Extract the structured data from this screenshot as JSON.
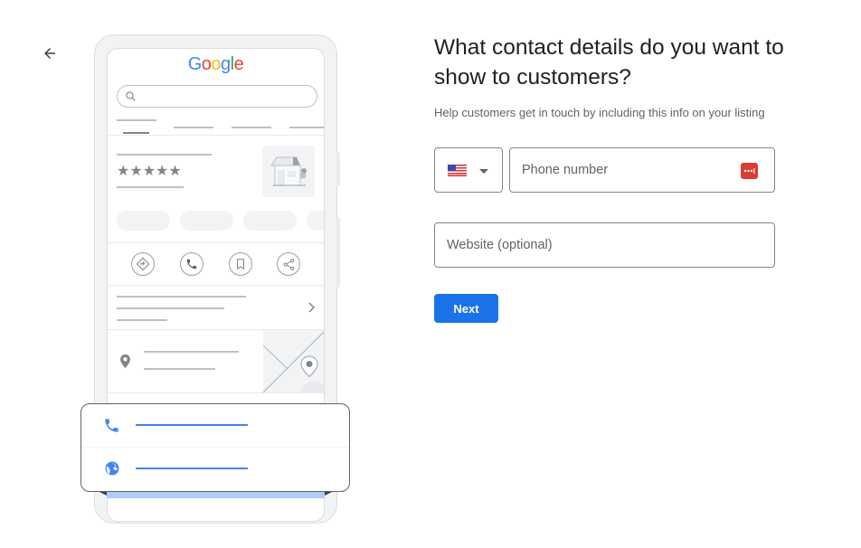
{
  "navigation": {
    "back_icon": "arrow-left-icon"
  },
  "illustration": {
    "brand_logo": {
      "letters": [
        "G",
        "o",
        "o",
        "g",
        "l",
        "e"
      ],
      "colors": [
        "#4285f4",
        "#ea4335",
        "#fbbc05",
        "#4285f4",
        "#34a853",
        "#ea4335"
      ]
    },
    "search_icon": "search-icon",
    "rating_stars": "★★★★★",
    "rating_value": 5,
    "action_icons": [
      "directions-icon",
      "phone-icon",
      "bookmark-icon",
      "share-icon"
    ],
    "callout_icons": [
      "phone-icon",
      "globe-icon"
    ]
  },
  "form": {
    "title": "What contact details do you want to show to customers?",
    "subtitle": "Help customers get in touch by including this info on your listing",
    "country_select": {
      "selected": "US",
      "flag_icon": "us-flag-icon"
    },
    "phone_field": {
      "value": "",
      "placeholder": "Phone number"
    },
    "website_field": {
      "value": "",
      "placeholder": "Website (optional)"
    },
    "next_label": "Next"
  },
  "colors": {
    "accent": "#1a73e8",
    "password_manager_icon": "#db3b35",
    "callout_link": "#4285f4"
  }
}
